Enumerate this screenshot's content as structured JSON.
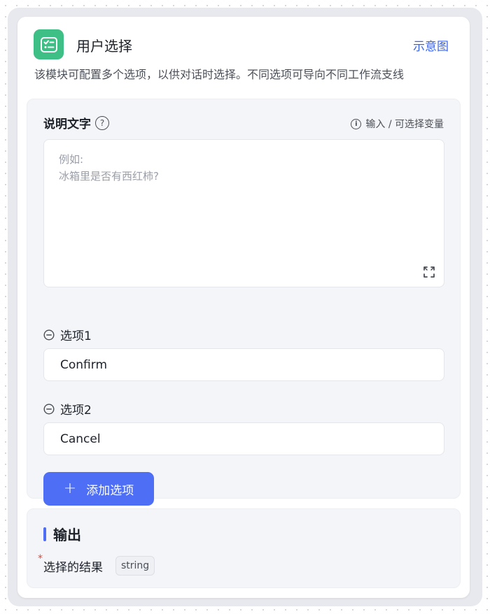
{
  "node": {
    "title": "用户选择",
    "preview_label": "示意图",
    "description": "该模块可配置多个选项，以供对话时选择。不同选项可导向不同工作流支线",
    "icon": "checklist-icon",
    "icon_color": "#3dbf85"
  },
  "description_field": {
    "label": "说明文字",
    "help_icon": "question-circle-icon",
    "hint": "输入 / 可选择变量",
    "hint_icon": "info-circle-icon",
    "value": "",
    "placeholder": "例如:\n冰箱里是否有西红柿?"
  },
  "options": [
    {
      "label": "选项1",
      "value": "Confirm",
      "remove_icon": "minus-circle-icon"
    },
    {
      "label": "选项2",
      "value": "Cancel",
      "remove_icon": "minus-circle-icon"
    }
  ],
  "add_option": {
    "label": "添加选项",
    "icon": "plus-icon",
    "color": "#4d6ef5"
  },
  "output": {
    "title": "输出",
    "result_label": "选择的结果",
    "required_mark": "*",
    "type": "string"
  },
  "colors": {
    "accent": "#4d6ef5",
    "link": "#3a63e6",
    "required": "#e5483d"
  }
}
